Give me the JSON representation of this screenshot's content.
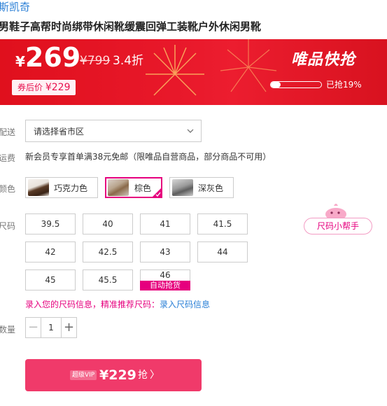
{
  "brand": "斯凯奇",
  "product_title": "男鞋子高帮时尚绑带休闲靴缓震回弹工装靴户外休闲男靴",
  "banner": {
    "currency": "¥",
    "price": "269",
    "original_price": "¥799",
    "discount": "3.4折",
    "coupon_label": "券后价",
    "coupon_price": "¥229",
    "flash_title": "唯品快抢",
    "progress_fraction": 0.19,
    "progress_text": "已抢19%"
  },
  "delivery": {
    "label": "配送",
    "select_value": "请选择省市区"
  },
  "shipping": {
    "label": "运费",
    "text": "新会员专享首单满38元免邮（限唯品自营商品，部分商品不可用）"
  },
  "color": {
    "label": "颜色",
    "options": [
      {
        "name": "巧克力色",
        "selected": false
      },
      {
        "name": "棕色",
        "selected": true
      },
      {
        "name": "深灰色",
        "selected": false
      }
    ]
  },
  "size": {
    "label": "尺码",
    "options": [
      "39.5",
      "40",
      "41",
      "41.5",
      "42",
      "42.5",
      "43",
      "44",
      "45",
      "45.5",
      "46"
    ],
    "sold_out_tag": "自动抢货",
    "helper": "尺码小帮手",
    "tip": "录入您的尺码信息，精准推荐尺码：",
    "tip_link": "录入尺码信息"
  },
  "quantity": {
    "label": "数量",
    "value": "1",
    "minus": "−",
    "plus": "+"
  },
  "buy": {
    "vip_tag": "超级VIP",
    "price": "¥229",
    "action": "抢",
    "arrow": "〉"
  },
  "colors": {
    "accent": "#e6007e",
    "banner_red": "#e8182a",
    "buy_button": "#f03a6a",
    "link_blue": "#2a7fd6"
  }
}
